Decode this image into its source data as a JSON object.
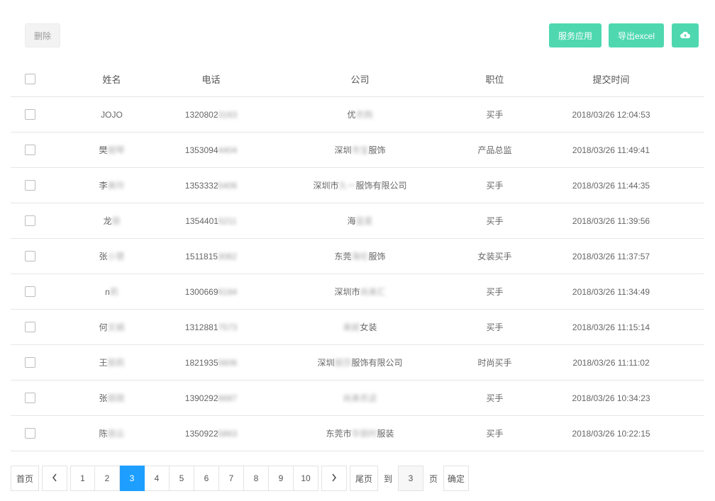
{
  "toolbar": {
    "delete_label": "删除",
    "service_label": "服务应用",
    "export_label": "导出excel",
    "cloud_icon": "cloud-upload-icon"
  },
  "table": {
    "headers": {
      "name": "姓名",
      "phone": "电话",
      "company": "公司",
      "position": "职位",
      "time": "提交时间"
    },
    "rows": [
      {
        "name": "JOJO",
        "name_hidden": "",
        "phone": "1320802",
        "phone_hidden": "3163",
        "company_pre": "优",
        "company_hidden": "衣购",
        "company_post": "",
        "position": "买手",
        "time": "2018/03/26 12:04:53"
      },
      {
        "name": "樊",
        "name_hidden": "丽琴",
        "phone": "1353094",
        "phone_hidden": "4404",
        "company_pre": "深圳",
        "company_hidden": "市宝",
        "company_post": "服饰",
        "position": "产品总监",
        "time": "2018/03/26 11:49:41"
      },
      {
        "name": "李",
        "name_hidden": "美玲",
        "phone": "1353332",
        "phone_hidden": "5406",
        "company_pre": "深圳市",
        "company_hidden": "久一",
        "company_post": "服饰有限公司",
        "position": "买手",
        "time": "2018/03/26 11:44:35"
      },
      {
        "name": "龙",
        "name_hidden": "丽",
        "phone": "1354401",
        "phone_hidden": "5211",
        "company_pre": "海",
        "company_hidden": "蓝星",
        "company_post": "",
        "position": "买手",
        "time": "2018/03/26 11:39:56"
      },
      {
        "name": "张",
        "name_hidden": "小慧",
        "phone": "1511815",
        "phone_hidden": "3082",
        "company_pre": "东莞",
        "company_hidden": "海伦",
        "company_post": "服饰",
        "position": "女装买手",
        "time": "2018/03/26 11:37:57"
      },
      {
        "name": "n",
        "name_hidden": "莉",
        "phone": "1300669",
        "phone_hidden": "6184",
        "company_pre": "深圳市",
        "company_hidden": "尚美汇",
        "company_post": "",
        "position": "买手",
        "time": "2018/03/26 11:34:49"
      },
      {
        "name": "何",
        "name_hidden": "文娟",
        "phone": "1312881",
        "phone_hidden": "7573",
        "company_pre": "",
        "company_hidden": "美妮",
        "company_post": "女装",
        "position": "买手",
        "time": "2018/03/26 11:15:14"
      },
      {
        "name": "王",
        "name_hidden": "丽莉",
        "phone": "1821935",
        "phone_hidden": "5606",
        "company_pre": "深圳",
        "company_hidden": "丽莎",
        "company_post": "服饰有限公司",
        "position": "时尚买手",
        "time": "2018/03/26 11:11:02"
      },
      {
        "name": "张",
        "name_hidden": "丽丽",
        "phone": "1390292",
        "phone_hidden": "6687",
        "company_pre": "",
        "company_hidden": "尚美衣这",
        "company_post": "",
        "position": "买手",
        "time": "2018/03/26 10:34:23"
      },
      {
        "name": "陈",
        "name_hidden": "丽云",
        "phone": "1350922",
        "phone_hidden": "5863",
        "company_pre": "东莞市",
        "company_hidden": "华丽时",
        "company_post": "服装",
        "position": "买手",
        "time": "2018/03/26 10:22:15"
      }
    ]
  },
  "pagination": {
    "first_label": "首页",
    "prev_icon": "chevron-left-icon",
    "pages": [
      "1",
      "2",
      "3",
      "4",
      "5",
      "6",
      "7",
      "8",
      "9",
      "10"
    ],
    "current_page": "3",
    "next_icon": "chevron-right-icon",
    "last_label": "尾页",
    "goto_label": "到",
    "goto_value": "3",
    "page_unit": "页",
    "confirm_label": "确定"
  },
  "colors": {
    "accent_green": "#4fd8b0",
    "active_page_blue": "#1e9fff"
  }
}
